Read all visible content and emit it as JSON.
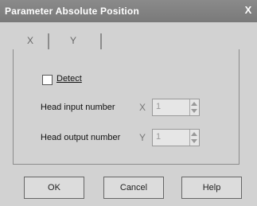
{
  "window": {
    "title": "Parameter Absolute Position",
    "close_glyph": "X"
  },
  "tabs": [
    {
      "label": "X"
    },
    {
      "label": "Y"
    }
  ],
  "form": {
    "detect_label": "Detect",
    "detect_checked": false,
    "head_input": {
      "label": "Head input number",
      "axis": "X",
      "value": "1"
    },
    "head_output": {
      "label": "Head output number",
      "axis": "Y",
      "value": "1"
    }
  },
  "buttons": {
    "ok": "OK",
    "cancel": "Cancel",
    "help": "Help"
  },
  "colors": {
    "titlebar": "#7a7a7a",
    "dialog_bg": "#d2d2d2"
  }
}
